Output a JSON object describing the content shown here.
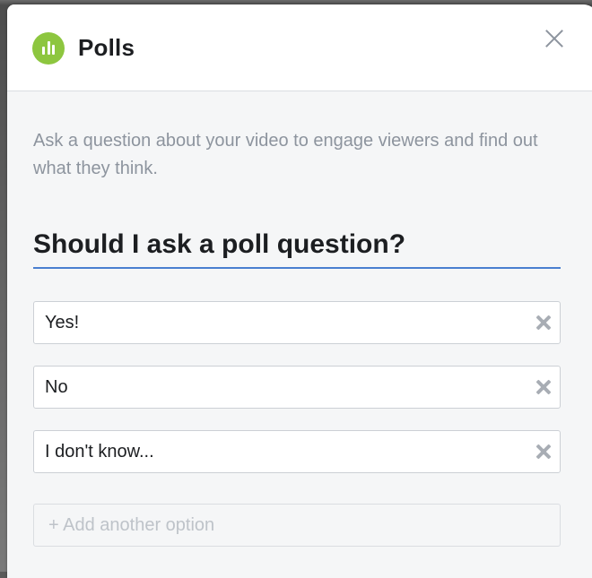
{
  "header": {
    "title": "Polls",
    "icon": "poll-chart-icon",
    "icon_color": "#8dc63f"
  },
  "description": "Ask a question about your video to engage viewers and find out what they think.",
  "question": "Should I ask a poll question?",
  "options": [
    {
      "label": "Yes!"
    },
    {
      "label": "No"
    },
    {
      "label": "I don't know..."
    }
  ],
  "add_option_placeholder": "+ Add another option",
  "colors": {
    "accent_underline": "#4a7fd0",
    "muted_text": "#8d949e"
  }
}
